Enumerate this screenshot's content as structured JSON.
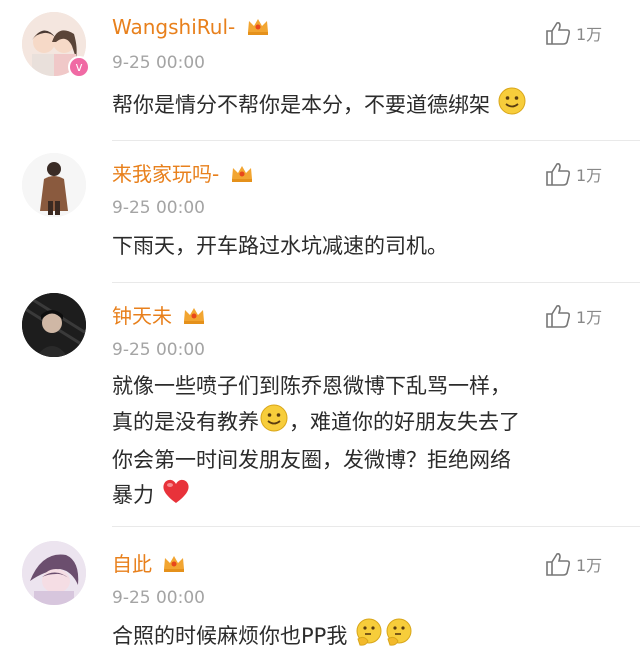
{
  "comments": [
    {
      "username": "WangshiRul-",
      "time": "9-25 00:00",
      "likes": "1万",
      "text": "帮你是情分不帮你是本分，不要道德绑架",
      "emoji_after": [
        "smile-emoji"
      ]
    },
    {
      "username": "来我家玩吗-",
      "time": "9-25 00:00",
      "likes": "1万",
      "text": "下雨天，开车路过水坑减速的司机。"
    },
    {
      "username": "钟天未",
      "time": "9-25 00:00",
      "likes": "1万",
      "text_lines": [
        "就像一些喷子们到陈乔恩微博下乱骂一样，",
        "真的是没有教养",
        "，难道你的好朋友失去了",
        "你会第一时间发朋友圈，发微博？拒绝网络",
        "暴力"
      ]
    },
    {
      "username": "自此",
      "time": "9-25 00:00",
      "likes": "1万",
      "text": "合照的时候麻烦你也PP我",
      "emoji_after": [
        "thinking-emoji",
        "thinking-emoji"
      ]
    }
  ],
  "colors": {
    "username": "#e8801c",
    "time": "#a4a4a4",
    "body_text": "#2b2b2b",
    "crown_gold": "#f2a531",
    "heart": "#e8323a",
    "emoji_yellow": "#f7cd3b"
  }
}
